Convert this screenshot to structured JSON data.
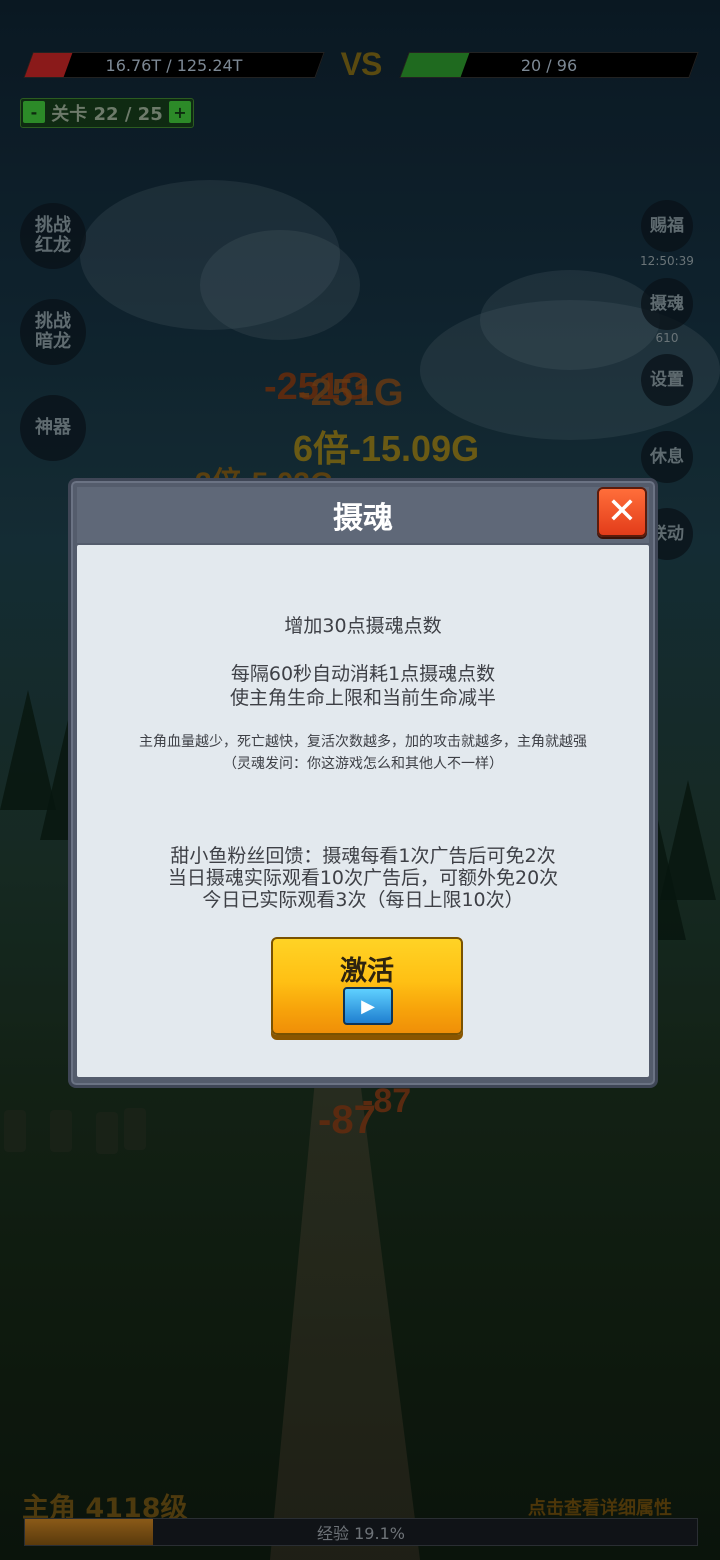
{
  "top": {
    "player_hp": "16.76T / 125.24T",
    "vs": "VS",
    "enemy_hp": "20 / 96",
    "player_hp_fraction": 0.134,
    "enemy_hp_fraction": 0.208
  },
  "level": {
    "minus": "-",
    "label": "关卡 22 / 25",
    "plus": "+"
  },
  "left_buttons": {
    "red_dragon": "挑战\n红龙",
    "dark_dragon": "挑战\n暗龙",
    "artifact": "神器"
  },
  "right_buttons": {
    "blessing": "赐福",
    "blessing_timer": "12:50:39",
    "soul": "摄魂",
    "soul_count": "610",
    "settings": "设置",
    "rest": "休息",
    "link": "联动"
  },
  "damage_texts": [
    "-251G",
    "-251G",
    "6倍-15.09G",
    "3倍-5.03G",
    "-87",
    "-87"
  ],
  "modal": {
    "title": "摄魂",
    "close": "✕",
    "line1": "增加30点摄魂点数",
    "line2": "每隔60秒自动消耗1点摄魂点数",
    "line3": "使主角生命上限和当前生命减半",
    "note1": "主角血量越少，死亡越快，复活次数越多，加的攻击就越多，主角就越强",
    "note2": "（灵魂发问：你这游戏怎么和其他人不一样）",
    "fan1": "甜小鱼粉丝回馈：摄魂每看1次广告后可免2次",
    "fan2": "当日摄魂实际观看10次广告后，可额外免20次",
    "fan3": "今日已实际观看3次（每日上限10次）",
    "activate": "激活",
    "play_icon": "play-video-icon"
  },
  "bottom": {
    "hero": "主角 4118级",
    "details": "点击查看详细属性",
    "exp": "经验 19.1%",
    "exp_fraction": 0.191
  },
  "colors": {
    "player_hp": "#8a1a1a",
    "enemy_hp": "#1f6a1f",
    "button_yellow": "#ffc014",
    "close_red": "#e33c1a"
  }
}
